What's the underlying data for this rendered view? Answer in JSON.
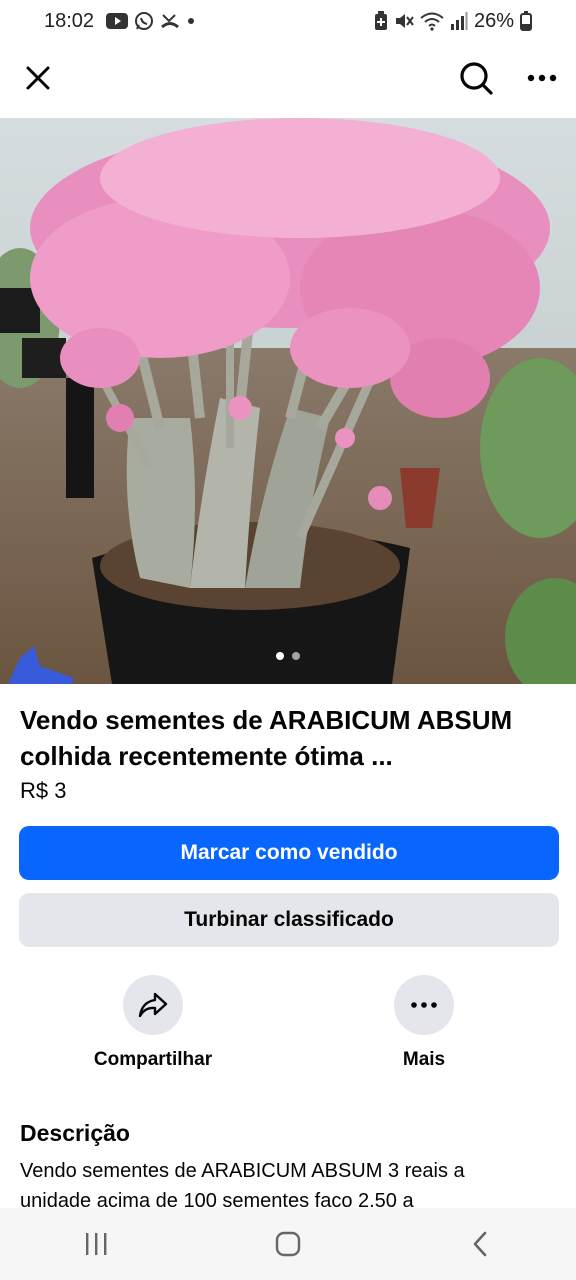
{
  "status_bar": {
    "time": "18:02",
    "battery": "26%",
    "left_icons": [
      "youtube-icon",
      "whatsapp-icon",
      "missed-call-icon",
      "dot-icon"
    ],
    "right_icons": [
      "battery-saver-icon",
      "mute-icon",
      "wifi-icon",
      "signal-icon",
      "battery-icon"
    ]
  },
  "top_bar": {
    "close_icon": "close-icon",
    "search_icon": "search-icon",
    "more_icon": "more-horizontal-icon"
  },
  "photo": {
    "image_count": 2,
    "active_index": 0
  },
  "listing": {
    "title": "Vendo sementes de ARABICUM ABSUM colhida  recentemente  ótima ...",
    "price": "R$ 3"
  },
  "buttons": {
    "mark_sold": "Marcar como vendido",
    "boost": "Turbinar classificado"
  },
  "actions": {
    "share": "Compartilhar",
    "more": "Mais"
  },
  "description": {
    "heading": "Descrição",
    "text": "Vendo sementes de ARABICUM ABSUM  3 reais a unidade acima de  100 sementes  faco 2.50 a"
  },
  "colors": {
    "primary": "#0866ff",
    "secondary_button": "#e4e6eb",
    "text": "#050505"
  }
}
